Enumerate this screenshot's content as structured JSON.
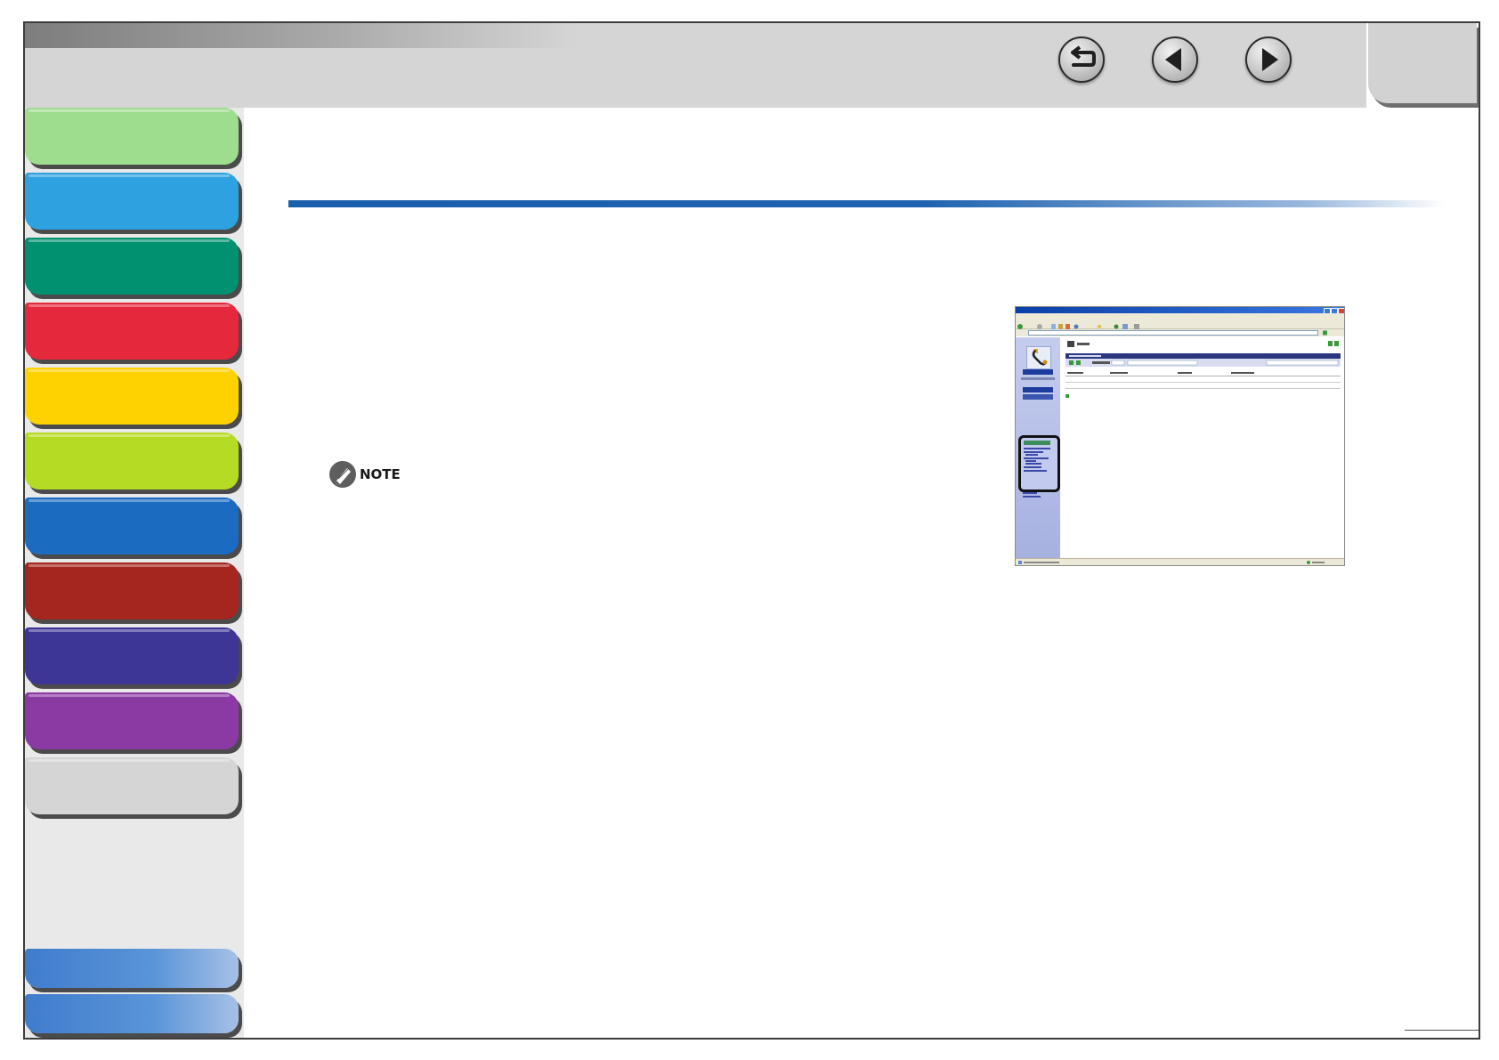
{
  "note": {
    "label": "NOTE"
  },
  "navigation": {
    "icons": [
      "back-icon",
      "previous-icon",
      "next-icon"
    ]
  },
  "sidebar_tab_colors": [
    "#9edc8e",
    "#2ea1e0",
    "#029170",
    "#e5283b",
    "#fed200",
    "#b5dc24",
    "#1b6bc1",
    "#a5251f",
    "#3d3696",
    "#8b3aa3",
    "#d5d5d5"
  ],
  "sidebar_bottom_colors": [
    "#4a85d0",
    "#4a85d0"
  ],
  "colors": {
    "title_rule": "#1a5fad",
    "frame_border": "#3c3c3c",
    "topbar": "#d5d5d5",
    "sidebar": "#e9e9e9"
  }
}
